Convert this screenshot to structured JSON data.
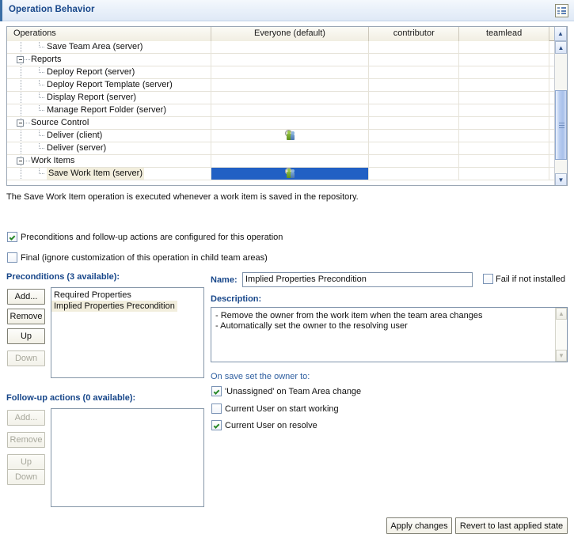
{
  "section": {
    "title": "Operation Behavior",
    "menu_icon": "list-menu-icon"
  },
  "table": {
    "columns": [
      "Operations",
      "Everyone (default)",
      "contributor",
      "teamlead"
    ],
    "rows": [
      {
        "label": "Save Team Area (server)",
        "level": 2,
        "type": "leaf",
        "everyone_icon": "",
        "selected": false,
        "highlight": false
      },
      {
        "label": "Reports",
        "level": 1,
        "type": "group",
        "everyone_icon": "",
        "selected": false,
        "highlight": false
      },
      {
        "label": "Deploy Report (server)",
        "level": 2,
        "type": "leaf",
        "everyone_icon": "",
        "selected": false,
        "highlight": false
      },
      {
        "label": "Deploy Report Template (server)",
        "level": 2,
        "type": "leaf",
        "everyone_icon": "",
        "selected": false,
        "highlight": false
      },
      {
        "label": "Display Report (server)",
        "level": 2,
        "type": "leaf",
        "everyone_icon": "",
        "selected": false,
        "highlight": false
      },
      {
        "label": "Manage Report Folder (server)",
        "level": 2,
        "type": "leaf",
        "everyone_icon": "",
        "selected": false,
        "highlight": false
      },
      {
        "label": "Source Control",
        "level": 1,
        "type": "group",
        "everyone_icon": "",
        "selected": false,
        "highlight": false
      },
      {
        "label": "Deliver (client)",
        "level": 2,
        "type": "leaf",
        "everyone_icon": "people-gear-icon",
        "selected": false,
        "highlight": false
      },
      {
        "label": "Deliver (server)",
        "level": 2,
        "type": "leaf",
        "everyone_icon": "",
        "selected": false,
        "highlight": false
      },
      {
        "label": "Work Items",
        "level": 1,
        "type": "group",
        "everyone_icon": "",
        "selected": false,
        "highlight": false
      },
      {
        "label": "Save Work Item (server)",
        "level": 2,
        "type": "leaf",
        "everyone_icon": "people-gear-icon",
        "selected": true,
        "highlight": true
      }
    ]
  },
  "operation_description": "The Save Work Item operation is executed whenever a work item is saved in the repository.",
  "options": {
    "configured": {
      "label": "Preconditions and follow-up actions are configured for this operation",
      "checked": true
    },
    "final": {
      "label": "Final (ignore customization of this operation in child team areas)",
      "checked": false
    }
  },
  "preconditions": {
    "title": "Preconditions (3 available):",
    "buttons": [
      {
        "label": "Add...",
        "enabled": true
      },
      {
        "label": "Remove",
        "enabled": true
      },
      {
        "label": "Up",
        "enabled": true
      },
      {
        "label": "Down",
        "enabled": false
      }
    ],
    "items": [
      {
        "label": "Required Properties",
        "selected": false
      },
      {
        "label": "Implied Properties Precondition",
        "selected": true
      }
    ]
  },
  "followup": {
    "title": "Follow-up actions (0 available):",
    "buttons": [
      {
        "label": "Add...",
        "enabled": false
      },
      {
        "label": "Remove",
        "enabled": false
      },
      {
        "label": "Up",
        "enabled": false
      },
      {
        "label": "Down",
        "enabled": false
      }
    ],
    "items": []
  },
  "detail": {
    "name_label": "Name:",
    "name_value": "Implied Properties Precondition",
    "fail_if_not_installed": {
      "label": "Fail if not installed",
      "checked": false
    },
    "description_label": "Description:",
    "description_lines": [
      "- Remove the owner from the work item when the team area changes",
      "- Automatically set the owner to the resolving user"
    ],
    "owner_section_label": "On save set the owner to:",
    "owner_options": [
      {
        "label": "'Unassigned' on Team Area change",
        "checked": true
      },
      {
        "label": "Current User on start working",
        "checked": false
      },
      {
        "label": "Current User on resolve",
        "checked": true
      }
    ]
  },
  "footer": {
    "apply_label": "Apply changes",
    "revert_label": "Revert to last applied state"
  },
  "colors": {
    "title_blue": "#18478a",
    "selection_blue": "#2160c4",
    "list_select_tan": "#f2eedd"
  }
}
